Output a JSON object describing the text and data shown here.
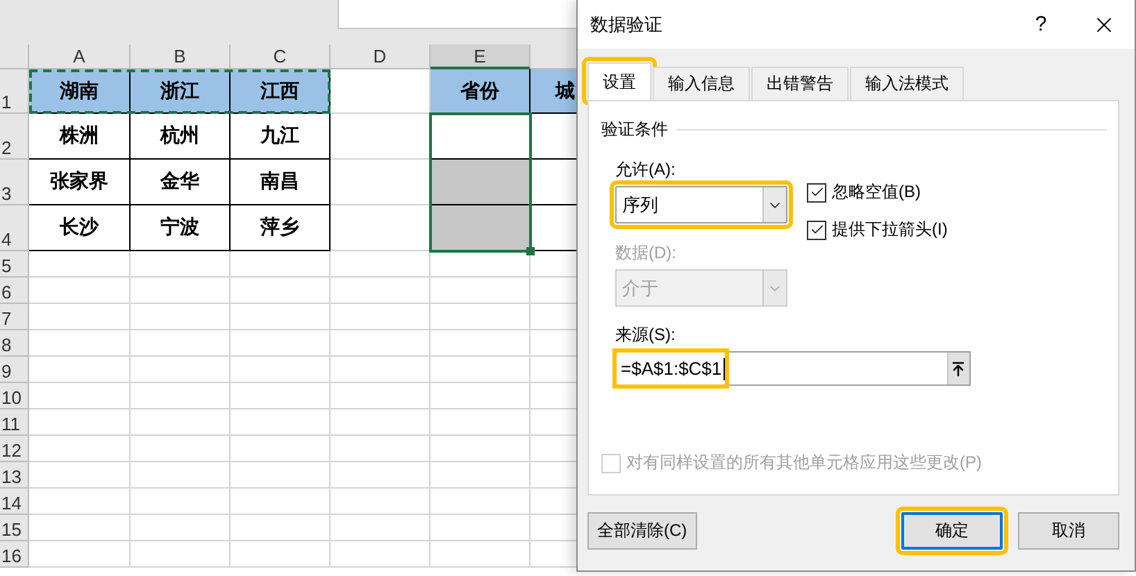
{
  "sheet": {
    "columns": [
      {
        "label": "A",
        "selected": false
      },
      {
        "label": "B",
        "selected": false
      },
      {
        "label": "C",
        "selected": false
      },
      {
        "label": "D",
        "selected": false
      },
      {
        "label": "E",
        "selected": true
      }
    ],
    "rows": [
      {
        "number": "1",
        "kind": "header",
        "values": [
          "湖南",
          "浙江",
          "江西"
        ],
        "e_text": "省份",
        "f_text": "城"
      },
      {
        "number": "2",
        "kind": "data",
        "values": [
          "株洲",
          "杭州",
          "九江"
        ],
        "e_shaded": false
      },
      {
        "number": "3",
        "kind": "data",
        "values": [
          "张家界",
          "金华",
          "南昌"
        ],
        "e_shaded": true
      },
      {
        "number": "4",
        "kind": "data",
        "values": [
          "长沙",
          "宁波",
          "萍乡"
        ],
        "e_shaded": true
      },
      {
        "number": "5",
        "kind": "empty"
      },
      {
        "number": "6",
        "kind": "empty"
      },
      {
        "number": "7",
        "kind": "empty"
      },
      {
        "number": "8",
        "kind": "empty"
      },
      {
        "number": "9",
        "kind": "empty"
      },
      {
        "number": "10",
        "kind": "empty"
      },
      {
        "number": "11",
        "kind": "empty"
      },
      {
        "number": "12",
        "kind": "empty"
      },
      {
        "number": "13",
        "kind": "empty"
      },
      {
        "number": "14",
        "kind": "empty"
      },
      {
        "number": "15",
        "kind": "empty"
      },
      {
        "number": "16",
        "kind": "empty"
      }
    ]
  },
  "dialog": {
    "title": "数据验证",
    "help": "?",
    "tabs": [
      {
        "label": "设置",
        "selected": true,
        "highlighted": true
      },
      {
        "label": "输入信息",
        "selected": false,
        "highlighted": false
      },
      {
        "label": "出错警告",
        "selected": false,
        "highlighted": false
      },
      {
        "label": "输入法模式",
        "selected": false,
        "highlighted": false
      }
    ],
    "group_title": "验证条件",
    "allow": {
      "label": "允许(A):",
      "value": "序列",
      "highlighted": true
    },
    "checkboxes": [
      {
        "label": "忽略空值(B)",
        "checked": true
      },
      {
        "label": "提供下拉箭头(I)",
        "checked": true
      }
    ],
    "data": {
      "label": "数据(D):",
      "value": "介于",
      "disabled": true
    },
    "source": {
      "label": "来源(S):",
      "value": "=$A$1:$C$1",
      "highlighted": true
    },
    "apply_all": {
      "label": "对有同样设置的所有其他单元格应用这些更改(P)",
      "checked": false,
      "disabled": true
    },
    "buttons": [
      {
        "label": "全部清除(C)",
        "kind": "clear",
        "focused": false,
        "highlighted": false
      },
      {
        "label": "确定",
        "kind": "ok",
        "focused": true,
        "highlighted": true
      },
      {
        "label": "取消",
        "kind": "cancel",
        "focused": false,
        "highlighted": false
      }
    ]
  }
}
